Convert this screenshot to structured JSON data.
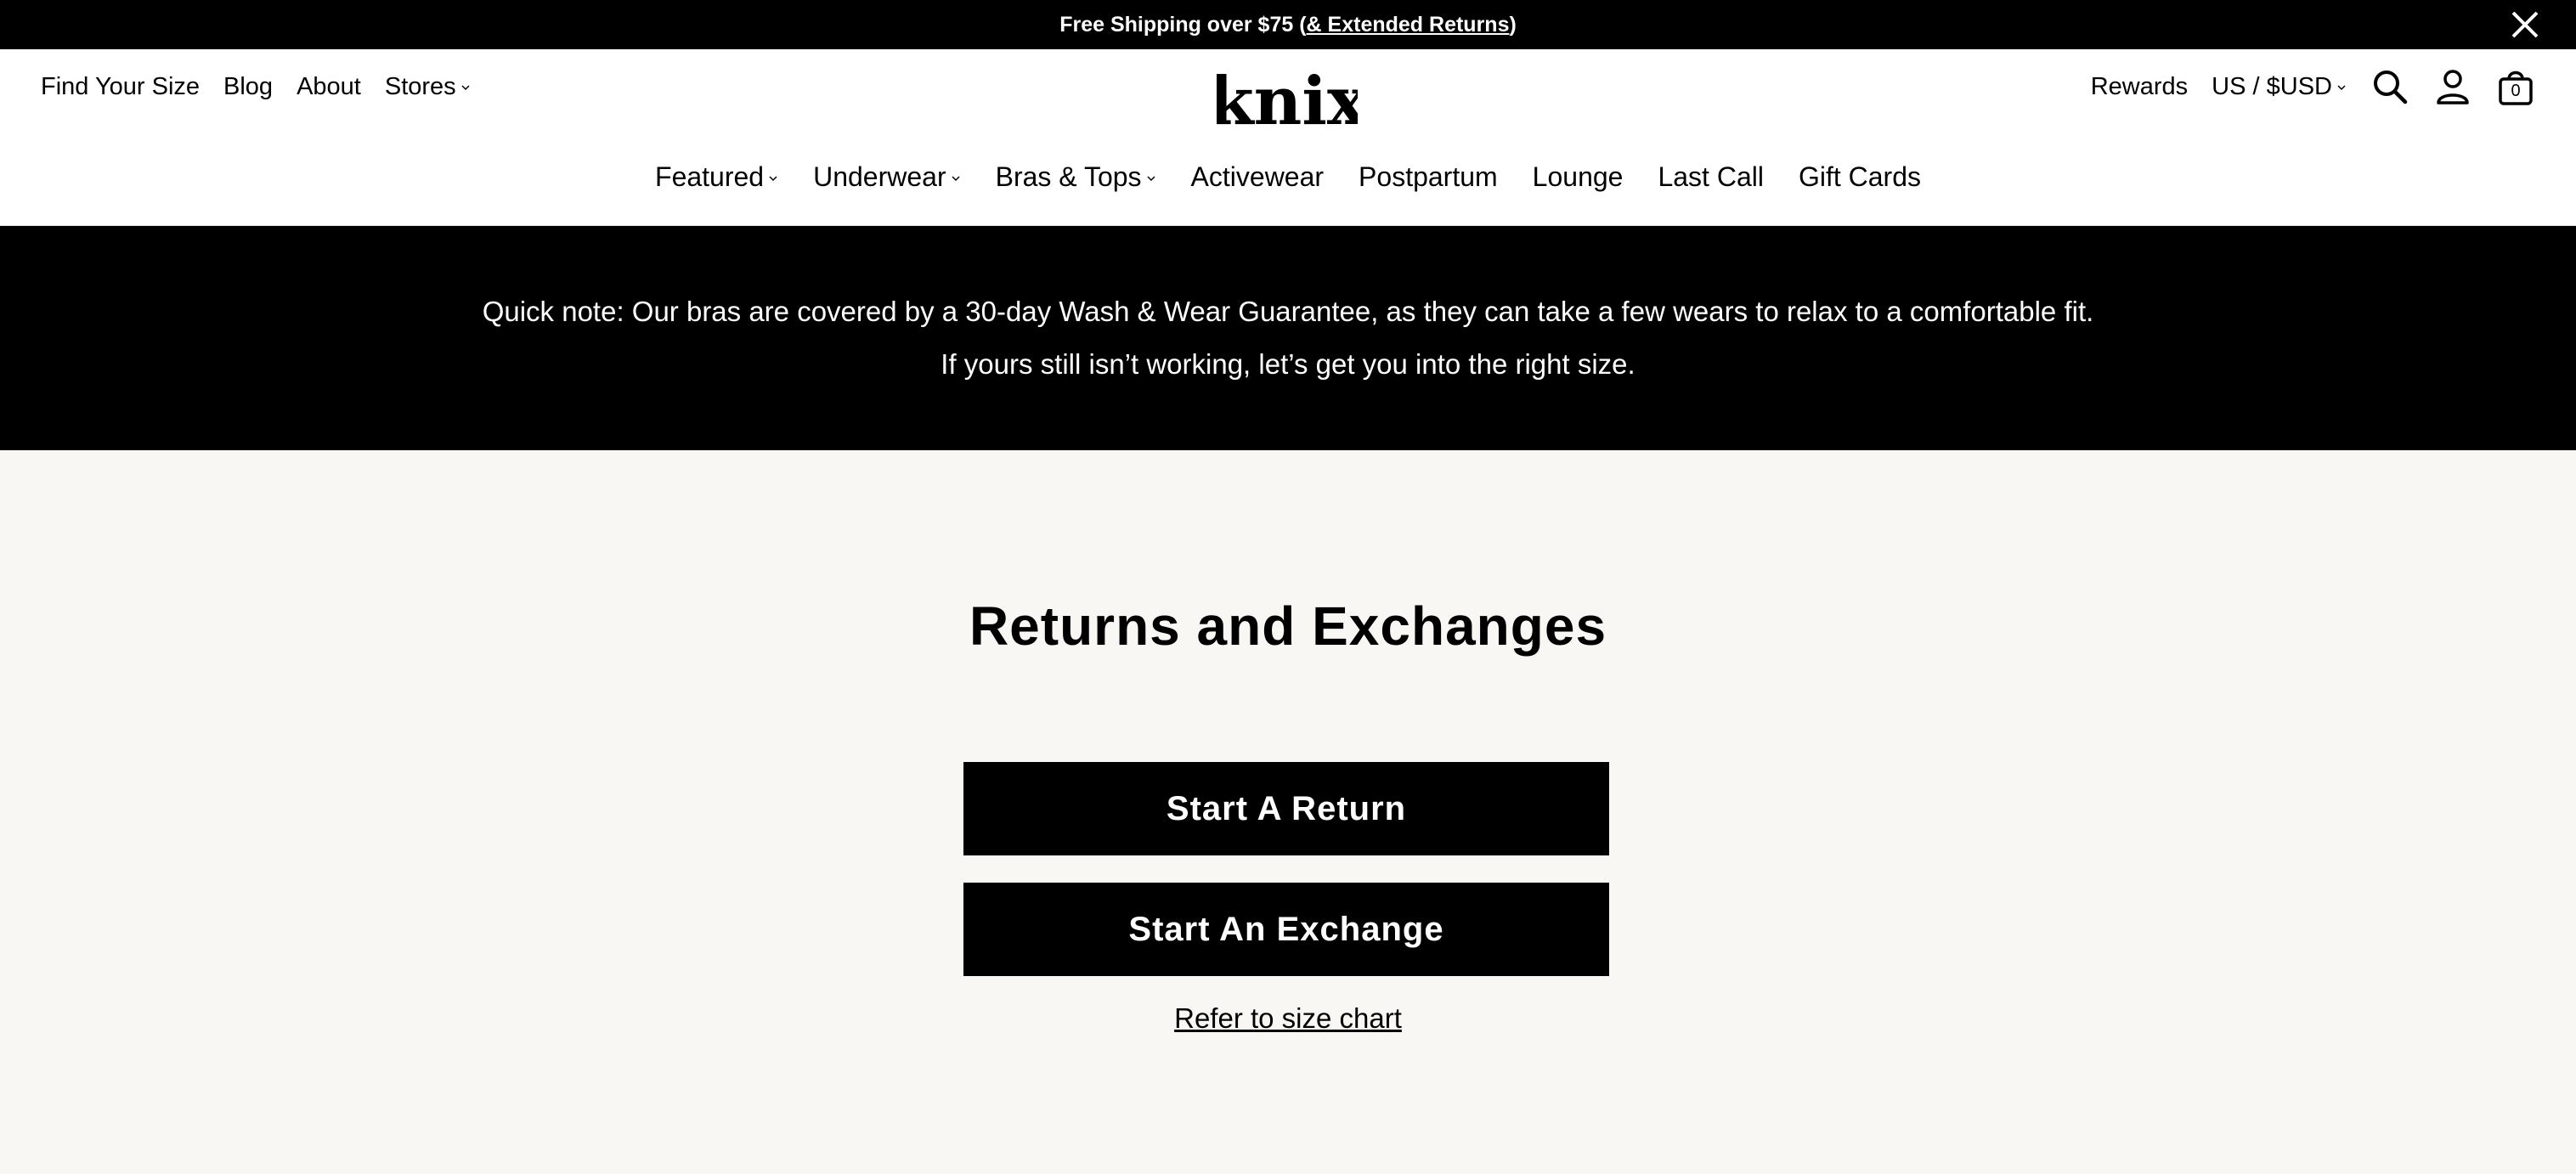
{
  "announcement": {
    "text_before": "Free Shipping over $75 (",
    "link": "& Extended Returns",
    "text_after": ")"
  },
  "utility_nav": {
    "left": [
      "Find Your Size",
      "Blog",
      "About",
      "Stores"
    ],
    "rewards": "Rewards",
    "currency": "US / $USD",
    "cart_count": "0"
  },
  "brand": {
    "logo_text": "knix"
  },
  "main_nav": [
    "Featured",
    "Underwear",
    "Bras & Tops",
    "Activewear",
    "Postpartum",
    "Lounge",
    "Last Call",
    "Gift Cards"
  ],
  "notice": {
    "line1": "Quick note: Our bras are covered by a 30-day Wash & Wear Guarantee, as they can take a few wears to relax to a comfortable fit.",
    "line2": "If yours still isn’t working, let’s get you into the right size."
  },
  "page": {
    "title": "Returns and Exchanges",
    "return_button": "Start A Return",
    "exchange_button": "Start An Exchange",
    "size_chart_link": "Refer to size chart"
  },
  "icons": {
    "close": "close-icon",
    "search": "search-icon",
    "account": "user-icon",
    "cart": "shopping-bag-icon",
    "dropdown": "chevron-down-icon"
  },
  "colors": {
    "black": "#000000",
    "background": "#f8f7f4",
    "white": "#ffffff"
  }
}
